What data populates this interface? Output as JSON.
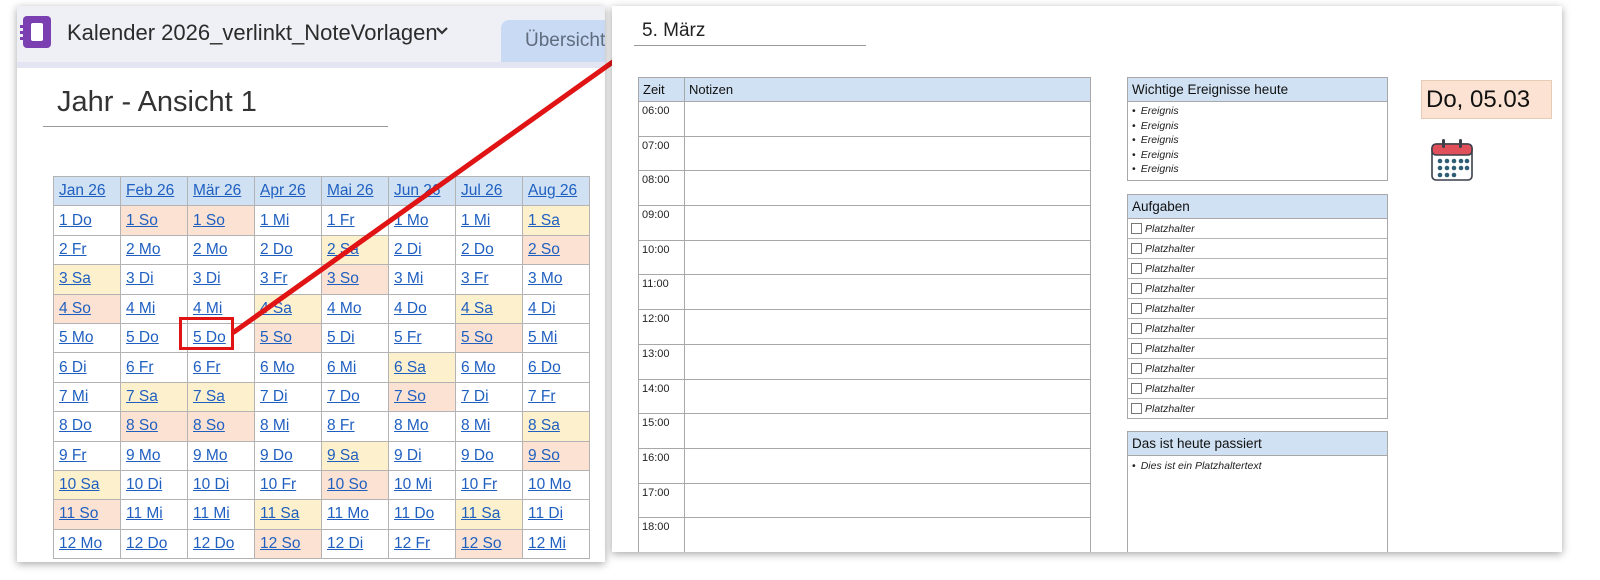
{
  "left": {
    "notebook_title": "Kalender 2026_verlinkt_NoteVorlagen",
    "tab_label": "Übersicht",
    "page_title": "Jahr - Ansicht 1",
    "months": [
      "Jan 26",
      "Feb 26",
      "Mär 26",
      "Apr 26",
      "Mai 26",
      "Jun 26",
      "Jul 26",
      "Aug 26"
    ],
    "rows": [
      [
        "1 Do",
        "1 So",
        "1 So",
        "1 Mi",
        "1 Fr",
        "1 Mo",
        "1 Mi",
        "1 Sa"
      ],
      [
        "2 Fr",
        "2 Mo",
        "2 Mo",
        "2 Do",
        "2 Sa",
        "2 Di",
        "2 Do",
        "2 So"
      ],
      [
        "3 Sa",
        "3 Di",
        "3 Di",
        "3 Fr",
        "3 So",
        "3 Mi",
        "3 Fr",
        "3 Mo"
      ],
      [
        "4 So",
        "4 Mi",
        "4 Mi",
        "4 Sa",
        "4 Mo",
        "4 Do",
        "4 Sa",
        "4 Di"
      ],
      [
        "5 Mo",
        "5 Do",
        "5 Do",
        "5 So",
        "5 Di",
        "5 Fr",
        "5 So",
        "5 Mi"
      ],
      [
        "6 Di",
        "6 Fr",
        "6 Fr",
        "6 Mo",
        "6 Mi",
        "6 Sa",
        "6 Mo",
        "6 Do"
      ],
      [
        "7 Mi",
        "7 Sa",
        "7 Sa",
        "7 Di",
        "7 Do",
        "7 So",
        "7 Di",
        "7 Fr"
      ],
      [
        "8 Do",
        "8 So",
        "8 So",
        "8 Mi",
        "8 Fr",
        "8 Mo",
        "8 Mi",
        "8 Sa"
      ],
      [
        "9 Fr",
        "9 Mo",
        "9 Mo",
        "9 Do",
        "9 Sa",
        "9 Di",
        "9 Do",
        "9 So"
      ],
      [
        "10 Sa",
        "10 Di",
        "10 Di",
        "10 Fr",
        "10 So",
        "10 Mi",
        "10 Fr",
        "10 Mo"
      ],
      [
        "11 So",
        "11 Mi",
        "11 Mi",
        "11 Sa",
        "11 Mo",
        "11 Do",
        "11 Sa",
        "11 Di"
      ],
      [
        "12 Mo",
        "12 Do",
        "12 Do",
        "12 So",
        "12 Di",
        "12 Fr",
        "12 So",
        "12 Mi"
      ]
    ],
    "highlighted_cell": "5 Do (Mär 26)"
  },
  "right": {
    "day_title": "5. März",
    "schedule": {
      "col_time": "Zeit",
      "col_notes": "Notizen",
      "times": [
        "06:00",
        "07:00",
        "08:00",
        "09:00",
        "10:00",
        "11:00",
        "12:00",
        "13:00",
        "14:00",
        "15:00",
        "16:00",
        "17:00",
        "18:00"
      ]
    },
    "events": {
      "title": "Wichtige Ereignisse heute",
      "items": [
        "Ereignis",
        "Ereignis",
        "Ereignis",
        "Ereignis",
        "Ereignis"
      ]
    },
    "tasks": {
      "title": "Aufgaben",
      "items": [
        "Platzhalter",
        "Platzhalter",
        "Platzhalter",
        "Platzhalter",
        "Platzhalter",
        "Platzhalter",
        "Platzhalter",
        "Platzhalter",
        "Platzhalter",
        "Platzhalter"
      ]
    },
    "today": {
      "title": "Das ist heute passiert",
      "items": [
        "Dies ist ein Platzhaltertext"
      ]
    },
    "date_label": "Do, 05.03"
  },
  "colors": {
    "header_blue": "#cfe1f3",
    "saturday": "#fdf0cc",
    "sunday": "#fbe2d2",
    "link": "#1f5fc0",
    "highlight_red": "#e01414",
    "notebook_purple": "#7a3fb0"
  },
  "icons": {
    "notebook": "onenote-notebook-icon",
    "chevron": "chevron-down-icon",
    "calendar": "calendar-icon"
  }
}
